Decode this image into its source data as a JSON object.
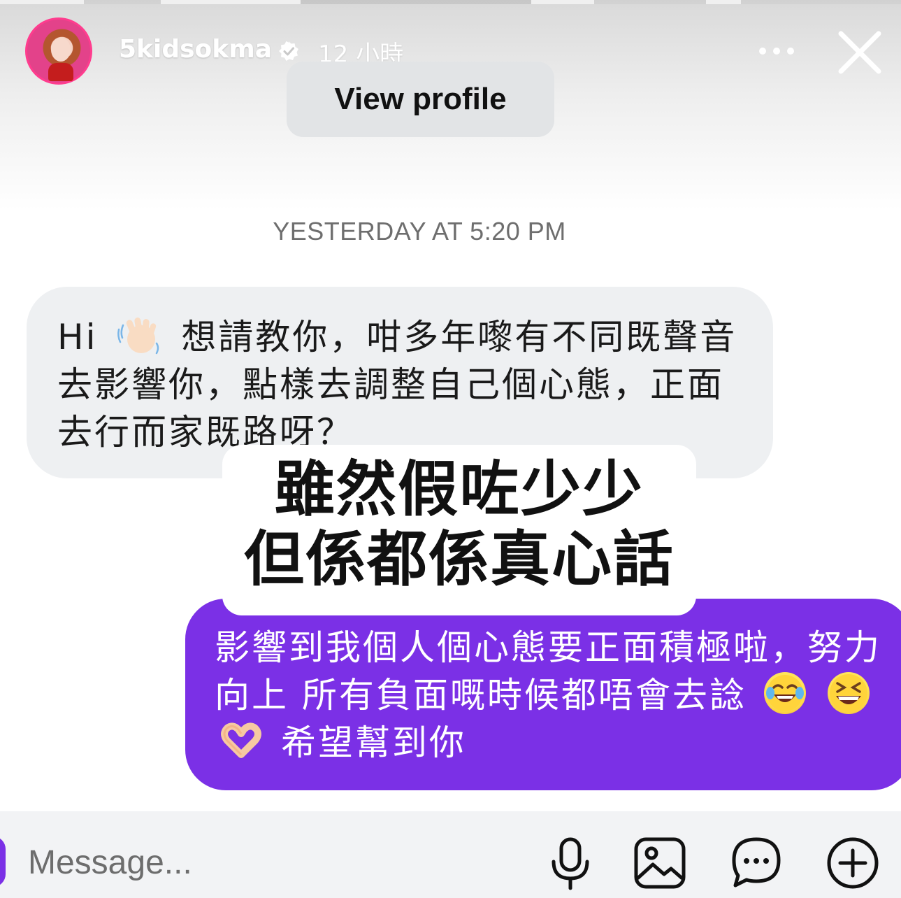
{
  "header": {
    "username": "5kidsokma",
    "time_ago": "12 小時",
    "view_profile_label": "View profile"
  },
  "conversation": {
    "timestamp": "YESTERDAY AT 5:20 PM",
    "incoming_message": {
      "line1_prefix": "Hi",
      "line1_suffix": "想請教你，咁多年嚟有不同既聲音",
      "line2": "去影響你，點樣去調整自己個心態，正面",
      "line3": "去行而家既路呀？"
    },
    "overlay_caption": {
      "line1": "雖然假咗少少",
      "line2": "但係都係真心話"
    },
    "outgoing_message": {
      "line1": "影響到我個人個心態要正面積極啦，努力",
      "line2_text": "向上 所有負面嘅時候都唔會去諗",
      "line3_text": "希望幫到你"
    }
  },
  "composer": {
    "placeholder": "Message..."
  },
  "icons": {
    "verified": "verified-badge-icon",
    "more": "more-options-icon",
    "close": "close-icon",
    "mic": "microphone-icon",
    "gallery": "gallery-icon",
    "sticker": "chat-bubble-icon",
    "add": "plus-circle-icon"
  },
  "colors": {
    "outgoing_bubble": "#7b30e6",
    "incoming_bubble": "#eef0f2"
  }
}
